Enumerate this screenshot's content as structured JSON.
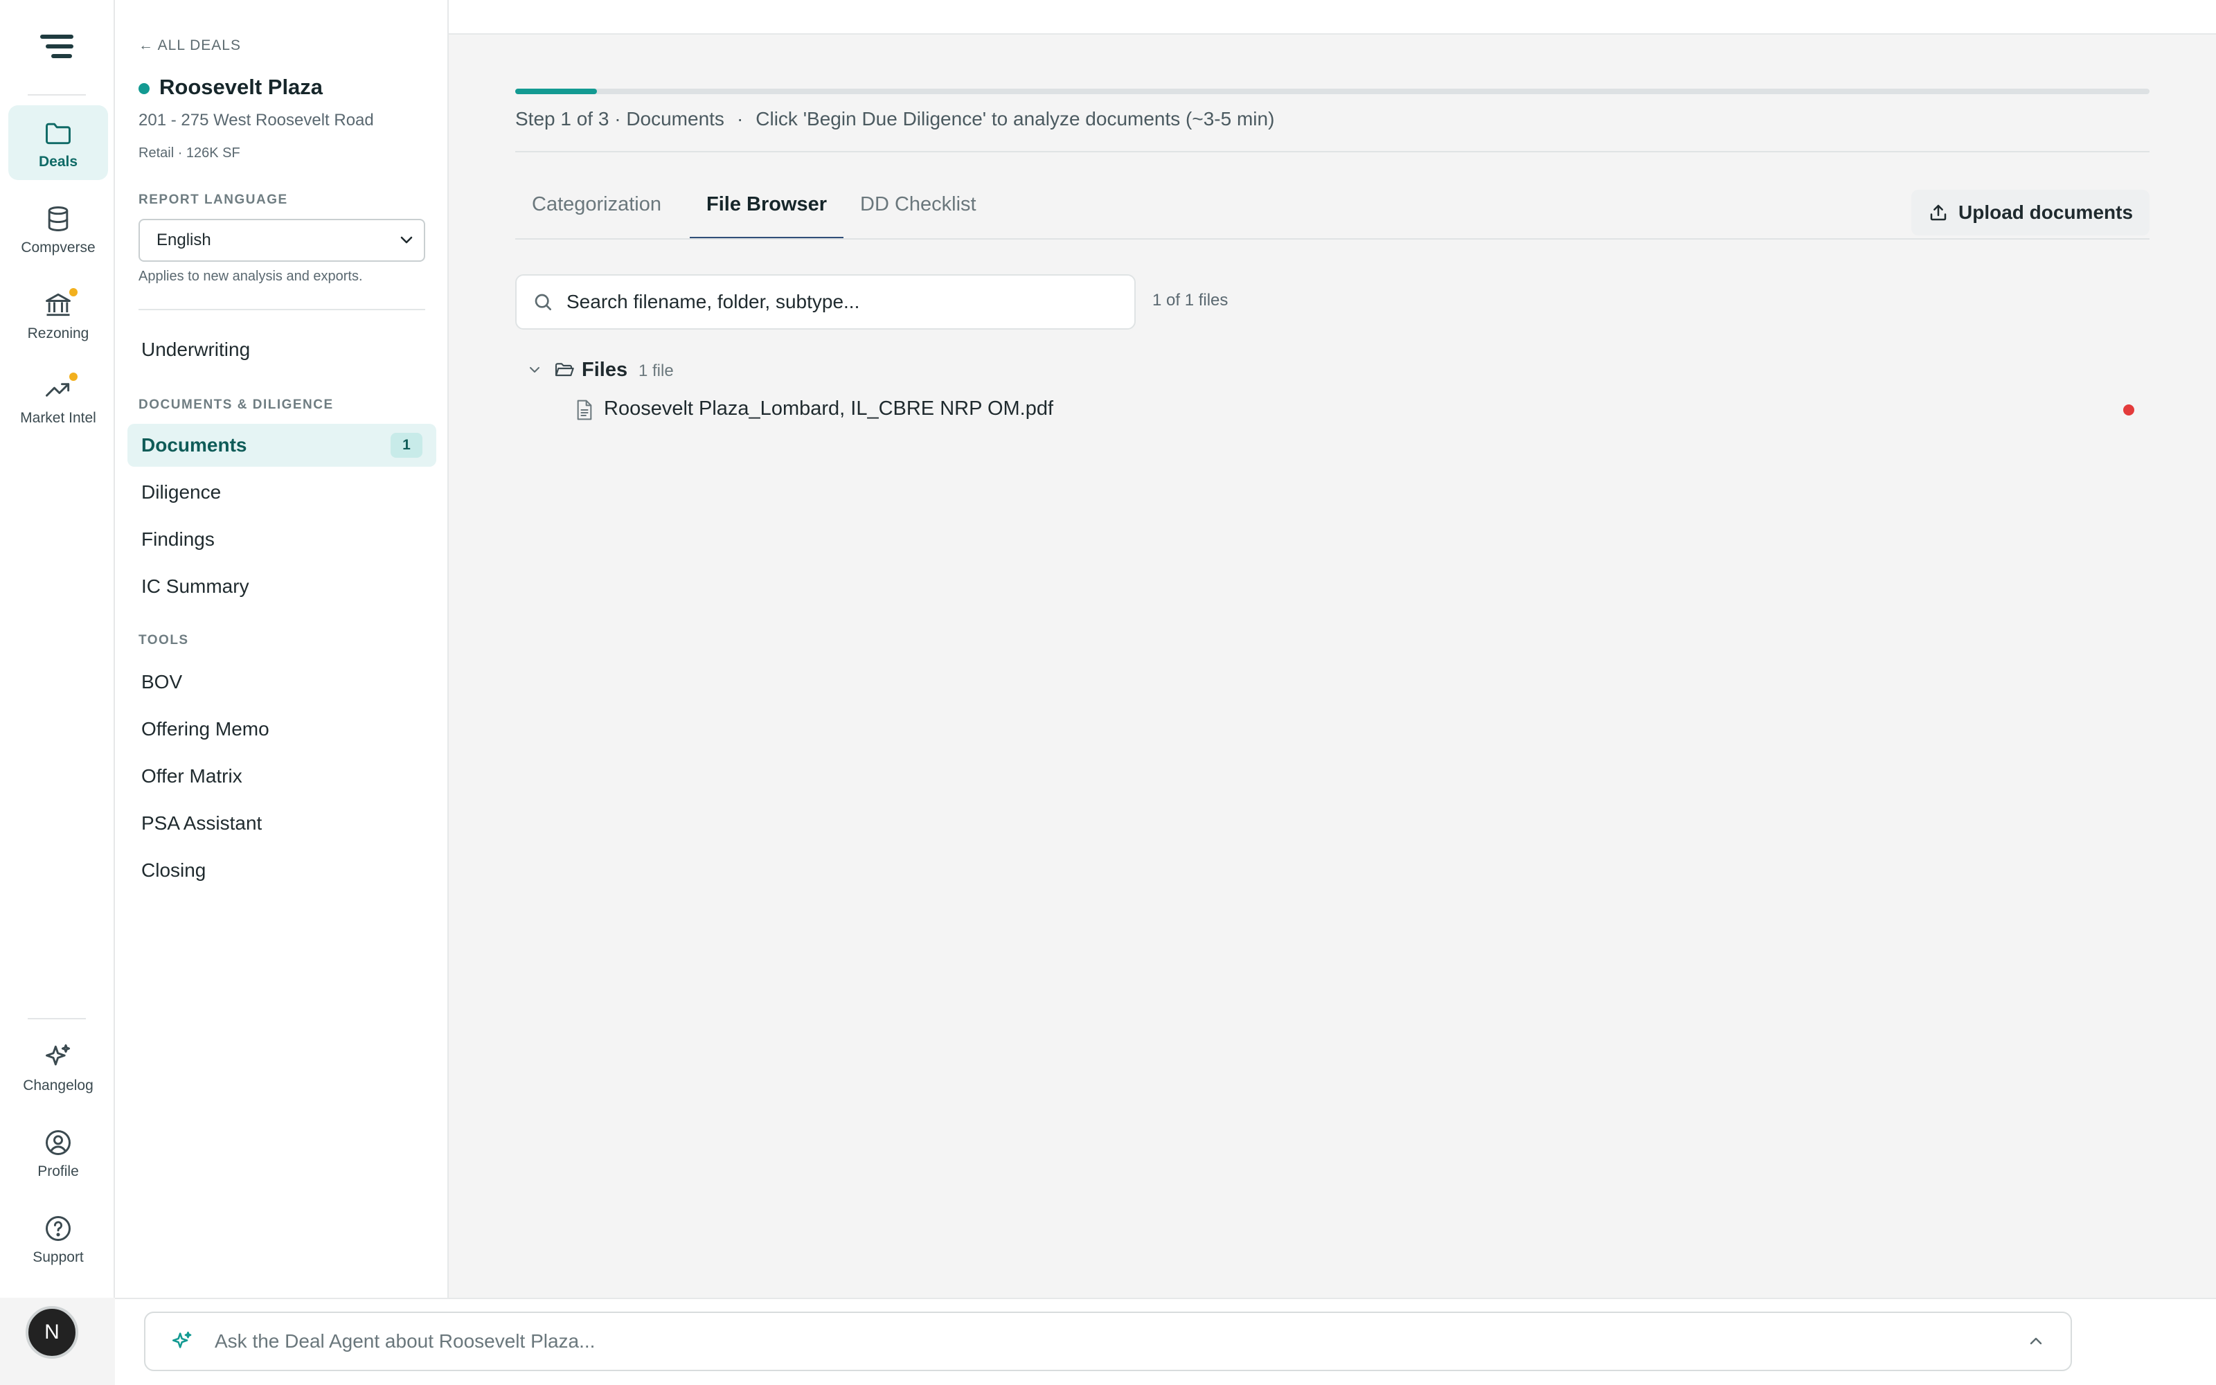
{
  "rail": {
    "items": [
      {
        "label": "Deals",
        "icon": "folder-icon"
      },
      {
        "label": "Compverse",
        "icon": "database-icon"
      },
      {
        "label": "Rezoning",
        "icon": "bank-icon"
      },
      {
        "label": "Market Intel",
        "icon": "trend-icon"
      },
      {
        "label": "Changelog",
        "icon": "sparkle-icon"
      },
      {
        "label": "Profile",
        "icon": "user-circle-icon"
      },
      {
        "label": "Support",
        "icon": "help-icon"
      }
    ],
    "avatar": "N"
  },
  "sidebar": {
    "back": "← ALL DEALS",
    "deal_title": "Roosevelt Plaza",
    "deal_address": "201 - 275 West Roosevelt Road",
    "deal_meta": "Retail · 126K SF",
    "report_language_label": "REPORT LANGUAGE",
    "report_language_value": "English",
    "report_language_help": "Applies to new analysis and exports.",
    "underwriting": "Underwriting",
    "docs_section": "DOCUMENTS & DILIGENCE",
    "docs_items": [
      {
        "label": "Documents",
        "badge": "1"
      },
      {
        "label": "Diligence"
      },
      {
        "label": "Findings"
      },
      {
        "label": "IC Summary"
      }
    ],
    "tools_section": "TOOLS",
    "tools_items": [
      "BOV",
      "Offering Memo",
      "Offer Matrix",
      "PSA Assistant",
      "Closing"
    ]
  },
  "main": {
    "progress_fraction": 0.05,
    "step_label": "Step 1 of 3 · Documents",
    "step_sep": "·",
    "step_hint": "Click 'Begin Due Diligence' to analyze documents (~3-5 min)",
    "tabs": [
      "Categorization",
      "File Browser",
      "DD Checklist"
    ],
    "active_tab": "File Browser",
    "upload_label": "Upload documents",
    "search_placeholder": "Search filename, folder, subtype...",
    "file_count": "1 of 1 files",
    "folder": {
      "name": "Files",
      "count": "1 file"
    },
    "files": [
      {
        "name": "Roosevelt Plaza_Lombard, IL_CBRE NRP OM.pdf",
        "status_color": "#e33b3b"
      }
    ]
  },
  "agent": {
    "placeholder": "Ask the Deal Agent about Roosevelt Plaza..."
  },
  "colors": {
    "accent": "#139a92",
    "tab_underline": "#2f4e78",
    "badge_dot": "#f2b01e"
  }
}
